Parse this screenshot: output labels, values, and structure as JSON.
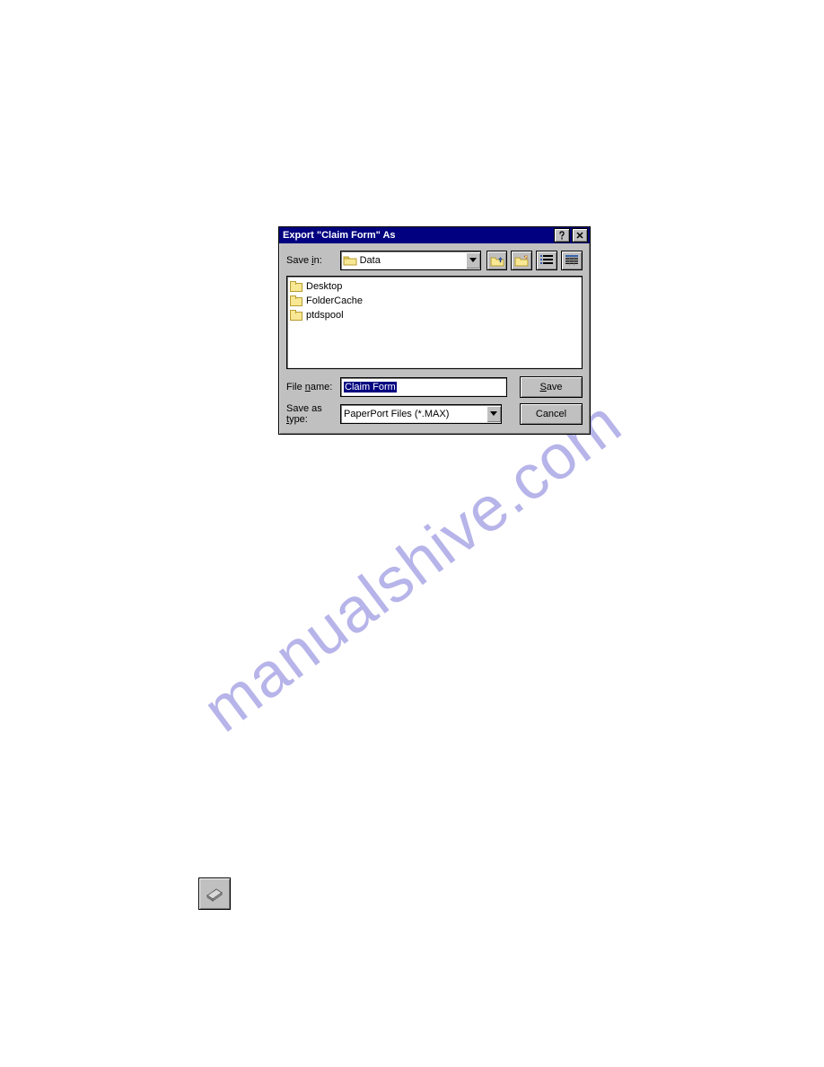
{
  "watermark": "manualshive.com",
  "dialog": {
    "title": "Export \"Claim Form\" As",
    "save_in_label_pre": "Save ",
    "save_in_label_accel": "i",
    "save_in_label_post": "n:",
    "save_in_value": "Data",
    "files": [
      {
        "name": "Desktop"
      },
      {
        "name": "FolderCache"
      },
      {
        "name": "ptdspool"
      }
    ],
    "file_name_label_pre": "File ",
    "file_name_label_accel": "n",
    "file_name_label_post": "ame:",
    "file_name_value": "Claim Form",
    "save_type_label_pre": "Save as ",
    "save_type_label_accel": "t",
    "save_type_label_post": "ype:",
    "save_type_value": "PaperPort Files (*.MAX)",
    "save_button_accel": "S",
    "save_button_rest": "ave",
    "cancel_button": "Cancel"
  }
}
